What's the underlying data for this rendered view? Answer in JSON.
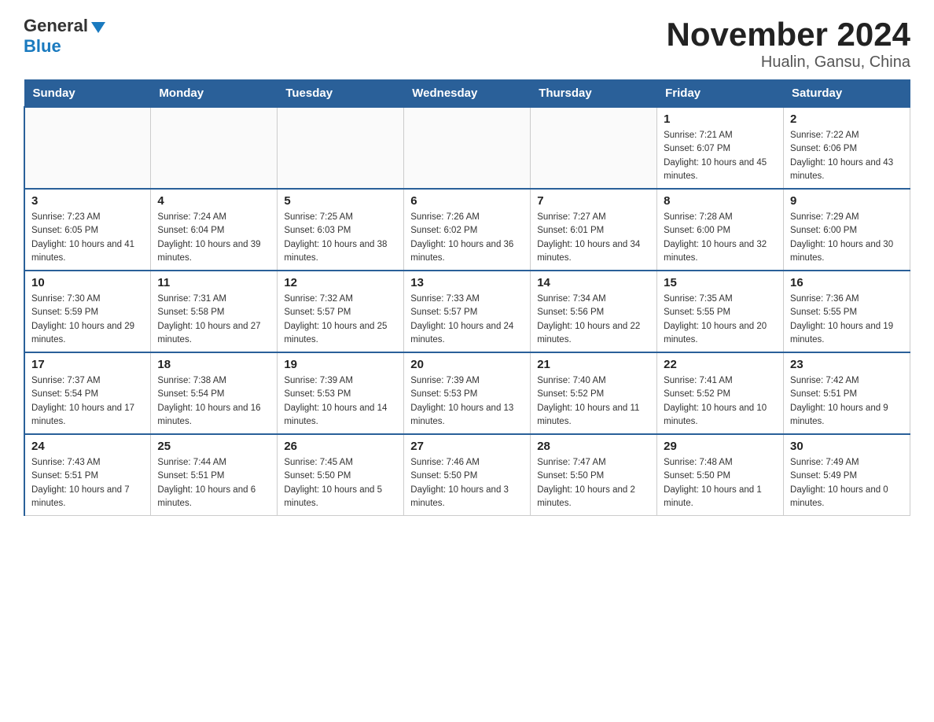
{
  "header": {
    "logo_general": "General",
    "logo_blue": "Blue",
    "month_year": "November 2024",
    "location": "Hualin, Gansu, China"
  },
  "days_of_week": [
    "Sunday",
    "Monday",
    "Tuesday",
    "Wednesday",
    "Thursday",
    "Friday",
    "Saturday"
  ],
  "weeks": [
    [
      {
        "day": "",
        "sunrise": "",
        "sunset": "",
        "daylight": ""
      },
      {
        "day": "",
        "sunrise": "",
        "sunset": "",
        "daylight": ""
      },
      {
        "day": "",
        "sunrise": "",
        "sunset": "",
        "daylight": ""
      },
      {
        "day": "",
        "sunrise": "",
        "sunset": "",
        "daylight": ""
      },
      {
        "day": "",
        "sunrise": "",
        "sunset": "",
        "daylight": ""
      },
      {
        "day": "1",
        "sunrise": "Sunrise: 7:21 AM",
        "sunset": "Sunset: 6:07 PM",
        "daylight": "Daylight: 10 hours and 45 minutes."
      },
      {
        "day": "2",
        "sunrise": "Sunrise: 7:22 AM",
        "sunset": "Sunset: 6:06 PM",
        "daylight": "Daylight: 10 hours and 43 minutes."
      }
    ],
    [
      {
        "day": "3",
        "sunrise": "Sunrise: 7:23 AM",
        "sunset": "Sunset: 6:05 PM",
        "daylight": "Daylight: 10 hours and 41 minutes."
      },
      {
        "day": "4",
        "sunrise": "Sunrise: 7:24 AM",
        "sunset": "Sunset: 6:04 PM",
        "daylight": "Daylight: 10 hours and 39 minutes."
      },
      {
        "day": "5",
        "sunrise": "Sunrise: 7:25 AM",
        "sunset": "Sunset: 6:03 PM",
        "daylight": "Daylight: 10 hours and 38 minutes."
      },
      {
        "day": "6",
        "sunrise": "Sunrise: 7:26 AM",
        "sunset": "Sunset: 6:02 PM",
        "daylight": "Daylight: 10 hours and 36 minutes."
      },
      {
        "day": "7",
        "sunrise": "Sunrise: 7:27 AM",
        "sunset": "Sunset: 6:01 PM",
        "daylight": "Daylight: 10 hours and 34 minutes."
      },
      {
        "day": "8",
        "sunrise": "Sunrise: 7:28 AM",
        "sunset": "Sunset: 6:00 PM",
        "daylight": "Daylight: 10 hours and 32 minutes."
      },
      {
        "day": "9",
        "sunrise": "Sunrise: 7:29 AM",
        "sunset": "Sunset: 6:00 PM",
        "daylight": "Daylight: 10 hours and 30 minutes."
      }
    ],
    [
      {
        "day": "10",
        "sunrise": "Sunrise: 7:30 AM",
        "sunset": "Sunset: 5:59 PM",
        "daylight": "Daylight: 10 hours and 29 minutes."
      },
      {
        "day": "11",
        "sunrise": "Sunrise: 7:31 AM",
        "sunset": "Sunset: 5:58 PM",
        "daylight": "Daylight: 10 hours and 27 minutes."
      },
      {
        "day": "12",
        "sunrise": "Sunrise: 7:32 AM",
        "sunset": "Sunset: 5:57 PM",
        "daylight": "Daylight: 10 hours and 25 minutes."
      },
      {
        "day": "13",
        "sunrise": "Sunrise: 7:33 AM",
        "sunset": "Sunset: 5:57 PM",
        "daylight": "Daylight: 10 hours and 24 minutes."
      },
      {
        "day": "14",
        "sunrise": "Sunrise: 7:34 AM",
        "sunset": "Sunset: 5:56 PM",
        "daylight": "Daylight: 10 hours and 22 minutes."
      },
      {
        "day": "15",
        "sunrise": "Sunrise: 7:35 AM",
        "sunset": "Sunset: 5:55 PM",
        "daylight": "Daylight: 10 hours and 20 minutes."
      },
      {
        "day": "16",
        "sunrise": "Sunrise: 7:36 AM",
        "sunset": "Sunset: 5:55 PM",
        "daylight": "Daylight: 10 hours and 19 minutes."
      }
    ],
    [
      {
        "day": "17",
        "sunrise": "Sunrise: 7:37 AM",
        "sunset": "Sunset: 5:54 PM",
        "daylight": "Daylight: 10 hours and 17 minutes."
      },
      {
        "day": "18",
        "sunrise": "Sunrise: 7:38 AM",
        "sunset": "Sunset: 5:54 PM",
        "daylight": "Daylight: 10 hours and 16 minutes."
      },
      {
        "day": "19",
        "sunrise": "Sunrise: 7:39 AM",
        "sunset": "Sunset: 5:53 PM",
        "daylight": "Daylight: 10 hours and 14 minutes."
      },
      {
        "day": "20",
        "sunrise": "Sunrise: 7:39 AM",
        "sunset": "Sunset: 5:53 PM",
        "daylight": "Daylight: 10 hours and 13 minutes."
      },
      {
        "day": "21",
        "sunrise": "Sunrise: 7:40 AM",
        "sunset": "Sunset: 5:52 PM",
        "daylight": "Daylight: 10 hours and 11 minutes."
      },
      {
        "day": "22",
        "sunrise": "Sunrise: 7:41 AM",
        "sunset": "Sunset: 5:52 PM",
        "daylight": "Daylight: 10 hours and 10 minutes."
      },
      {
        "day": "23",
        "sunrise": "Sunrise: 7:42 AM",
        "sunset": "Sunset: 5:51 PM",
        "daylight": "Daylight: 10 hours and 9 minutes."
      }
    ],
    [
      {
        "day": "24",
        "sunrise": "Sunrise: 7:43 AM",
        "sunset": "Sunset: 5:51 PM",
        "daylight": "Daylight: 10 hours and 7 minutes."
      },
      {
        "day": "25",
        "sunrise": "Sunrise: 7:44 AM",
        "sunset": "Sunset: 5:51 PM",
        "daylight": "Daylight: 10 hours and 6 minutes."
      },
      {
        "day": "26",
        "sunrise": "Sunrise: 7:45 AM",
        "sunset": "Sunset: 5:50 PM",
        "daylight": "Daylight: 10 hours and 5 minutes."
      },
      {
        "day": "27",
        "sunrise": "Sunrise: 7:46 AM",
        "sunset": "Sunset: 5:50 PM",
        "daylight": "Daylight: 10 hours and 3 minutes."
      },
      {
        "day": "28",
        "sunrise": "Sunrise: 7:47 AM",
        "sunset": "Sunset: 5:50 PM",
        "daylight": "Daylight: 10 hours and 2 minutes."
      },
      {
        "day": "29",
        "sunrise": "Sunrise: 7:48 AM",
        "sunset": "Sunset: 5:50 PM",
        "daylight": "Daylight: 10 hours and 1 minute."
      },
      {
        "day": "30",
        "sunrise": "Sunrise: 7:49 AM",
        "sunset": "Sunset: 5:49 PM",
        "daylight": "Daylight: 10 hours and 0 minutes."
      }
    ]
  ]
}
